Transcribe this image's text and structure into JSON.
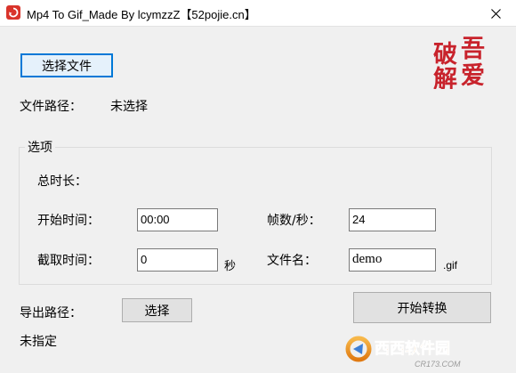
{
  "window": {
    "title": "Mp4 To Gif_Made By lcymzzZ【52pojie.cn】",
    "close_glyph": "✕"
  },
  "stamp": {
    "chars": [
      "吾",
      "爱",
      "破",
      "解"
    ],
    "color": "#c8232c"
  },
  "file": {
    "select_button": "选择文件",
    "path_label": "文件路径：",
    "path_value": "未选择"
  },
  "options": {
    "group_title": "选项",
    "duration_label": "总时长：",
    "start_time_label": "开始时间：",
    "start_time_value": "00:00",
    "clip_time_label": "截取时间：",
    "clip_time_value": "0",
    "clip_time_unit": "秒",
    "fps_label": "帧数/秒：",
    "fps_value": "24",
    "filename_label": "文件名：",
    "filename_value": "demo",
    "filename_ext": ".gif"
  },
  "export": {
    "path_label": "导出路径：",
    "select_button": "选择",
    "path_value": "未指定",
    "convert_button": "开始转换"
  },
  "watermark": {
    "text": "西西软件园",
    "domain": "CR173.COM",
    "accent": "#e07a12"
  }
}
